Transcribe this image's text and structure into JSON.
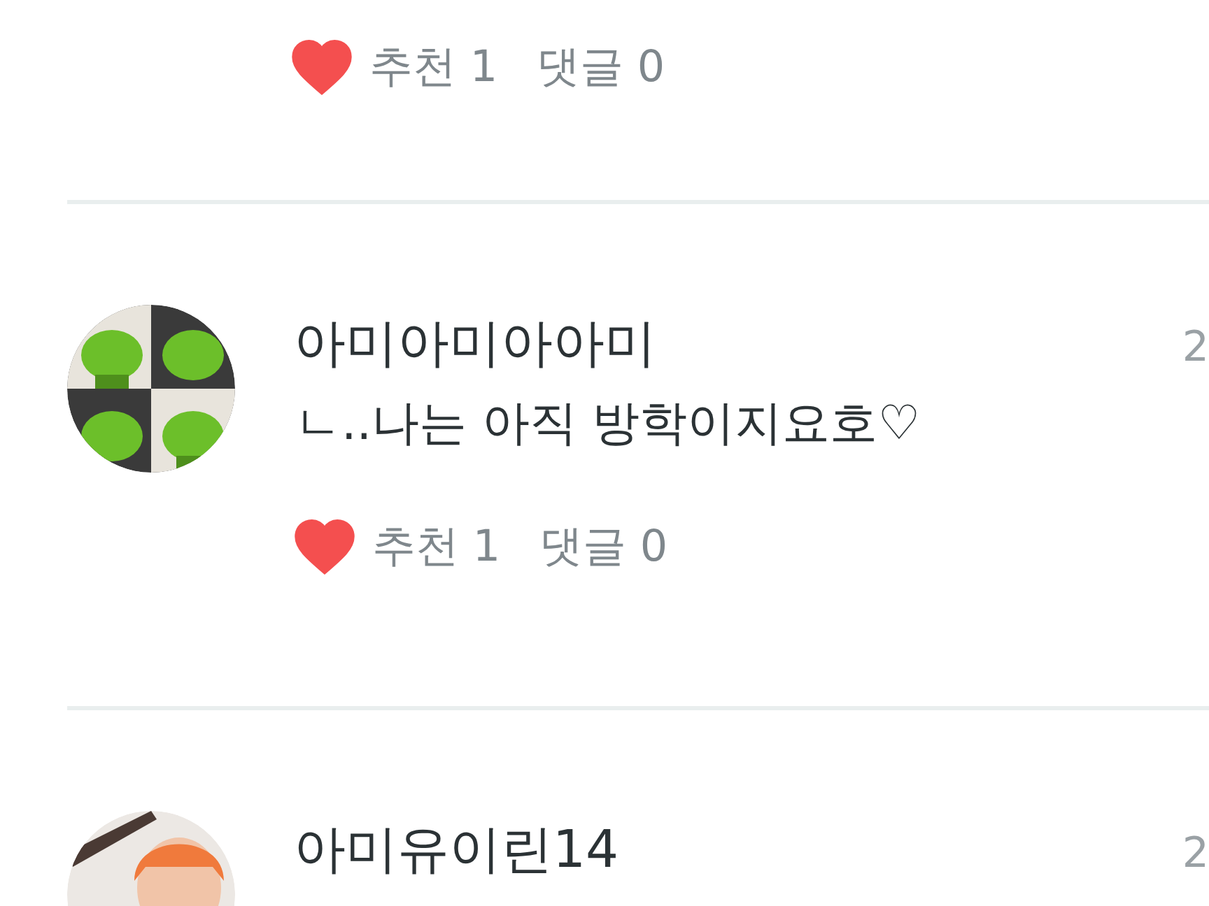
{
  "top_comment": {
    "actions": {
      "liked": true,
      "likes": "추천 1",
      "replies": "댓글 0"
    }
  },
  "comments": [
    {
      "author": "아미아미아아미",
      "time": "2",
      "text": "ㄴ..나는 아직 방학이지요호♡",
      "actions": {
        "liked": true,
        "likes": "추천 1",
        "replies": "댓글 0"
      }
    },
    {
      "author": "아미유이린14",
      "time": "2"
    }
  ]
}
